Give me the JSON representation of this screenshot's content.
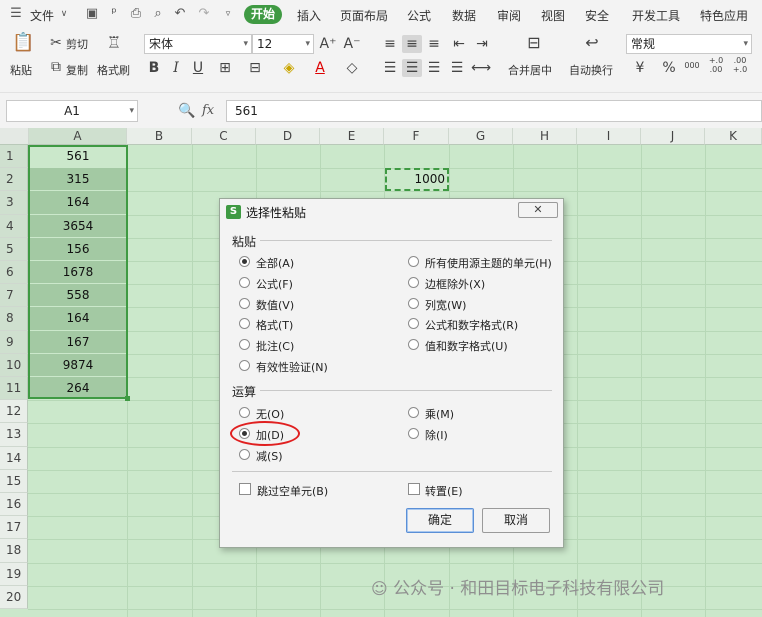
{
  "menubar": {
    "file": "文件",
    "tabs": [
      "开始",
      "插入",
      "页面布局",
      "公式",
      "数据",
      "审阅",
      "视图",
      "安全",
      "开发工具",
      "特色应用"
    ]
  },
  "ribbon": {
    "paste": "粘贴",
    "cut": "剪切",
    "copy": "复制",
    "format_painter": "格式刷",
    "font_name": "宋体",
    "font_size": "12",
    "merge_center": "合并居中",
    "wrap_text": "自动换行",
    "number_format": "常规",
    "percent": "%",
    "thousands": "000",
    "inc_decimal": "+.0\n.00",
    "dec_decimal": ".00\n+.0"
  },
  "formula_bar": {
    "cell_ref": "A1",
    "fx": "fx",
    "value": "561"
  },
  "grid": {
    "columns": [
      "A",
      "B",
      "C",
      "D",
      "E",
      "F",
      "G",
      "H",
      "I",
      "J",
      "K"
    ],
    "rows": [
      "1",
      "2",
      "3",
      "4",
      "5",
      "6",
      "7",
      "8",
      "9",
      "10",
      "11",
      "12",
      "13",
      "14",
      "15",
      "16",
      "17",
      "18",
      "19",
      "20"
    ],
    "column_a_values": [
      "561",
      "315",
      "164",
      "3654",
      "156",
      "1678",
      "558",
      "164",
      "167",
      "9874",
      "264"
    ],
    "copied_cell_value": "1000"
  },
  "dialog": {
    "title": "选择性粘贴",
    "close": "✕",
    "paste_section": "粘贴",
    "paste_options_left": [
      "全部(A)",
      "公式(F)",
      "数值(V)",
      "格式(T)",
      "批注(C)",
      "有效性验证(N)"
    ],
    "paste_options_right": [
      "所有使用源主题的单元(H)",
      "边框除外(X)",
      "列宽(W)",
      "公式和数字格式(R)",
      "值和数字格式(U)"
    ],
    "operation_section": "运算",
    "operation_left": [
      "无(O)",
      "加(D)",
      "减(S)"
    ],
    "operation_right": [
      "乘(M)",
      "除(I)"
    ],
    "skip_blanks": "跳过空单元(B)",
    "transpose": "转置(E)",
    "ok": "确定",
    "cancel": "取消",
    "selected_paste": "全部(A)",
    "selected_operation": "加(D)"
  },
  "watermark": "公众号 · 和田目标电子科技有限公司",
  "colors": {
    "accent": "#3f9a43",
    "grid_bg": "#cbe8cb",
    "selection": "#a3c9a3",
    "highlight_circle": "#e02020"
  }
}
